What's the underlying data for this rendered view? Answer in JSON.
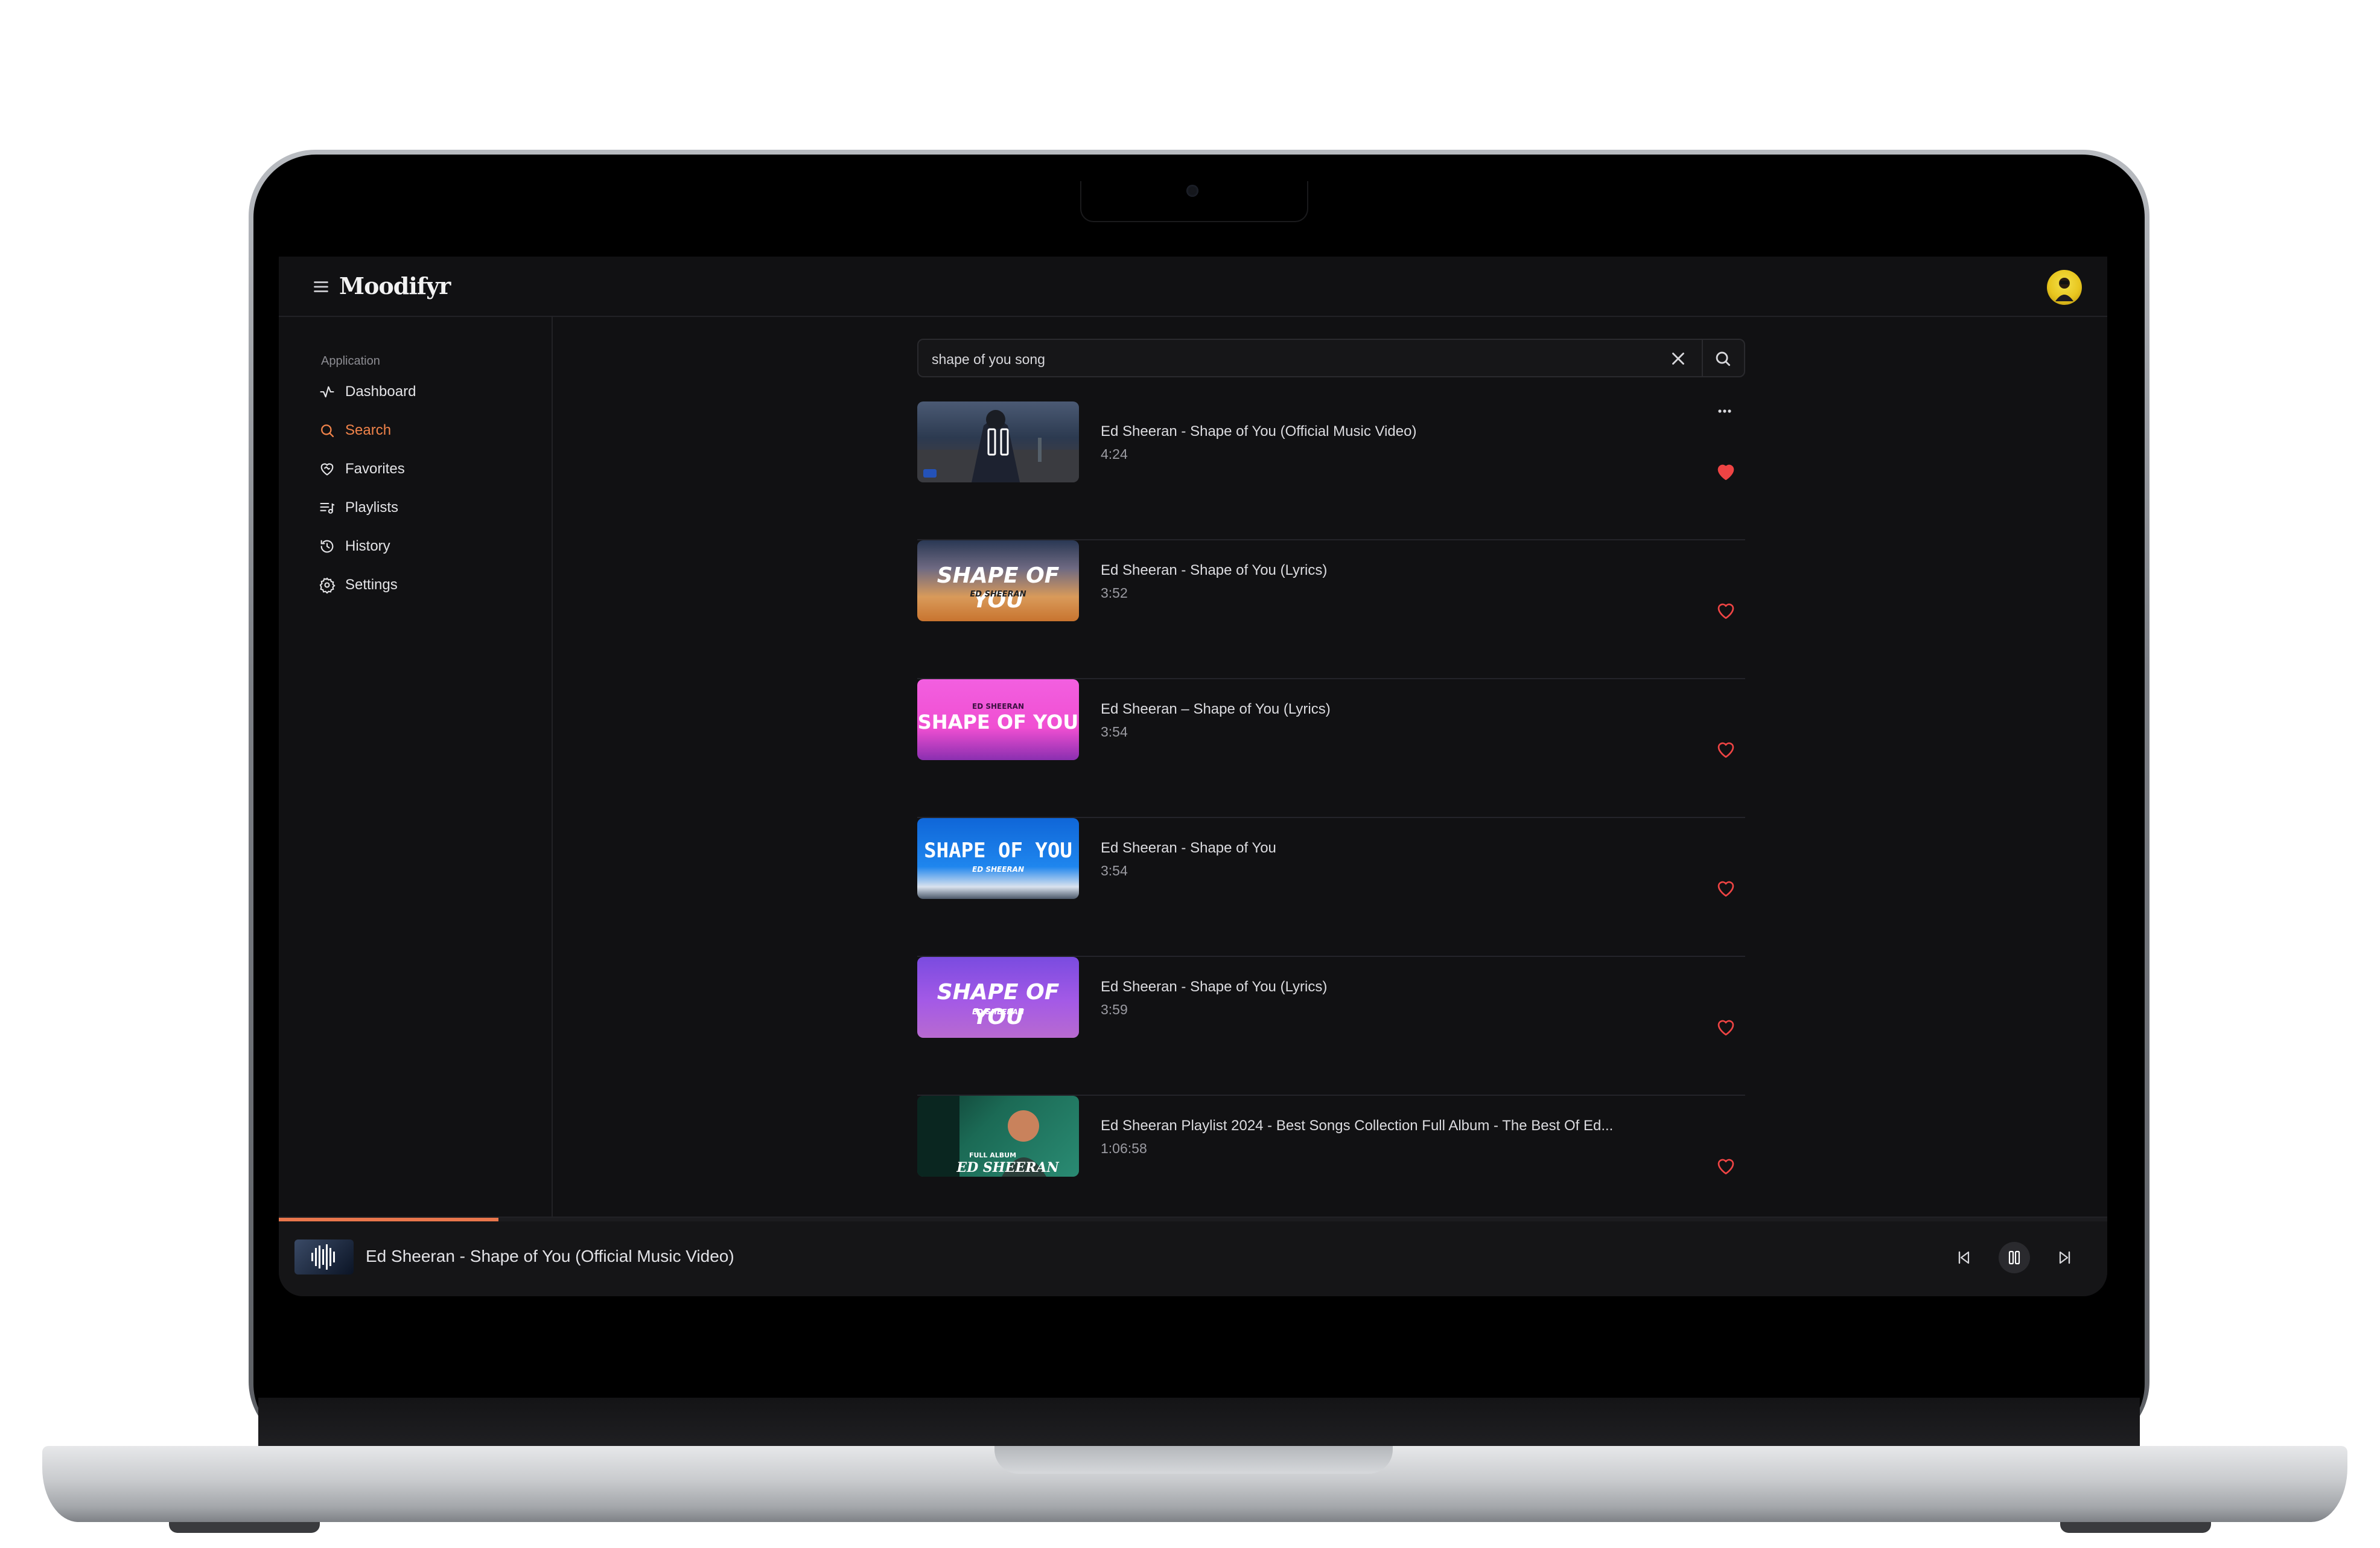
{
  "app": {
    "name": "Moodifyr",
    "menu_icon": "hamburger-icon",
    "avatar_icon": "user-avatar"
  },
  "sidebar": {
    "group_label": "Application",
    "items": [
      {
        "label": "Dashboard",
        "icon": "activity-icon",
        "active": false
      },
      {
        "label": "Search",
        "icon": "search-icon",
        "active": true
      },
      {
        "label": "Favorites",
        "icon": "heart-handshake-icon",
        "active": false
      },
      {
        "label": "Playlists",
        "icon": "playlist-icon",
        "active": false
      },
      {
        "label": "History",
        "icon": "history-icon",
        "active": false
      },
      {
        "label": "Settings",
        "icon": "gear-icon",
        "active": false
      }
    ]
  },
  "search": {
    "value": "shape of you song",
    "clear_icon": "close-icon",
    "submit_icon": "search-icon"
  },
  "results": [
    {
      "title": "Ed Sheeran - Shape of You (Official Music Video)",
      "duration": "4:24",
      "favorited": true,
      "playing": true
    },
    {
      "title": "Ed Sheeran - Shape of You (Lyrics)",
      "duration": "3:52",
      "favorited": false,
      "thumb_text": "SHAPE OF YOU",
      "thumb_sub": "ED SHEERAN"
    },
    {
      "title": "Ed Sheeran – Shape of You (Lyrics)",
      "duration": "3:54",
      "favorited": false,
      "thumb_text": "SHAPE OF YOU",
      "thumb_sub": "ED SHEERAN"
    },
    {
      "title": "Ed Sheeran - Shape of You",
      "duration": "3:54",
      "favorited": false,
      "thumb_text": "SHAPE OF YOU",
      "thumb_sub": "ED SHEERAN"
    },
    {
      "title": "Ed Sheeran - Shape of You (Lyrics)",
      "duration": "3:59",
      "favorited": false,
      "thumb_text": "SHAPE OF YOU",
      "thumb_sub": "ED SHEERAN"
    },
    {
      "title": "Ed Sheeran Playlist 2024 - Best Songs Collection Full Album - The Best Of Ed...",
      "duration": "1:06:58",
      "favorited": false,
      "thumb_text": "ED SHEERAN",
      "thumb_sub": "FULL ALBUM"
    }
  ],
  "player": {
    "now_playing": "Ed Sheeran - Shape of You (Official Music Video)",
    "progress_percent": 12,
    "controls": [
      "skip-back-icon",
      "pause-icon",
      "skip-forward-icon"
    ]
  },
  "colors": {
    "accent": "#f0834a",
    "heart": "#ef4444",
    "background": "#111113"
  }
}
